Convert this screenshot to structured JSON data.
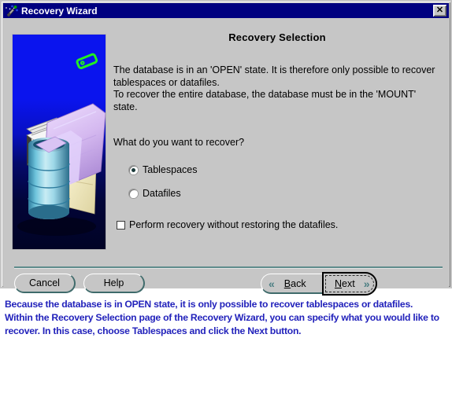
{
  "window": {
    "title": "Recovery Wizard",
    "title_icon": "wizard-wand-icon",
    "close_label": "✕"
  },
  "content": {
    "page_title": "Recovery Selection",
    "body_text": "The database is in an 'OPEN' state. It is therefore only possible to recover tablespaces or datafiles.\nTo recover the entire database, the database must be in the 'MOUNT' state.",
    "question": "What do you want to recover?",
    "options": [
      {
        "label": "Tablespaces",
        "selected": true
      },
      {
        "label": "Datafiles",
        "selected": false
      }
    ],
    "checkbox": {
      "label": "Perform recovery without restoring the datafiles.",
      "checked": false
    },
    "illustration_alt": "database-cylinder-with-folders-illustration"
  },
  "buttons": {
    "cancel": "Cancel",
    "help": "Help",
    "back_mnemonic": "B",
    "back_rest": "ack",
    "next_mnemonic": "N",
    "next_rest": "ext",
    "back_chevron": "«",
    "next_chevron": "»"
  },
  "caption": {
    "text": "Because the database is in OPEN state, it is only possible to recover tablespaces or datafiles. Within the Recovery Selection page of the Recovery Wizard, you can specify what you would like to recover. In this case, choose Tablespaces and click the Next button."
  },
  "colors": {
    "titlebar": "#000080",
    "window_face": "#c6c6c6",
    "caption_text": "#2222bb",
    "chevron": "#4a7e82",
    "illustration_top": "#0a14ee"
  }
}
